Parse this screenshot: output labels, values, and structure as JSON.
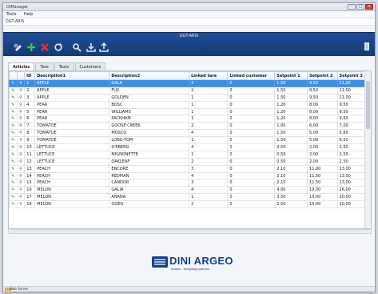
{
  "window": {
    "title": "DIManager"
  },
  "menu": {
    "items": [
      "Tools",
      "Help"
    ]
  },
  "path": {
    "text": "DGT-ARIS"
  },
  "toolbar": {
    "app_title": "DGT-ARIS",
    "accent_color": "#1f4f94"
  },
  "tabs": [
    "Articles",
    "Tare",
    "Texts",
    "Customers"
  ],
  "grid": {
    "columns": [
      "",
      "",
      "ID",
      "Description1",
      "Description2",
      "Linked tare",
      "Linked customer",
      "Setpoint 1",
      "Setpoint 2",
      "Setpoint 3"
    ],
    "rows": [
      [
        "1",
        "APPLE",
        "GALA",
        "2",
        "0",
        "1,50",
        "9,50",
        "11,00"
      ],
      [
        "2",
        "APPLE",
        "FUJI",
        "2",
        "0",
        "1,50",
        "9,50",
        "11,00"
      ],
      [
        "3",
        "APPLE",
        "GOLDEN",
        "1",
        "0",
        "1,50",
        "9,50",
        "11,00"
      ],
      [
        "4",
        "PEAR",
        "BOSC",
        "1",
        "0",
        "1,20",
        "8,00",
        "9,50"
      ],
      [
        "5",
        "PEAR",
        "WILLIAMS",
        "1",
        "0",
        "1,20",
        "8,00",
        "9,50"
      ],
      [
        "6",
        "PEAR",
        "PACKHAM",
        "1",
        "0",
        "1,20",
        "8,00",
        "9,50"
      ],
      [
        "7",
        "TOMATOE",
        "GOOSE CREEK",
        "2",
        "0",
        "1,00",
        "6,00",
        "7,00"
      ],
      [
        "8",
        "TOMATOE",
        "MOSCO",
        "4",
        "0",
        "1,50",
        "5,00",
        "5,60"
      ],
      [
        "9",
        "TOMATOE",
        "LONG-TOM",
        "1",
        "0",
        "1,50",
        "5,00",
        "6,50"
      ],
      [
        "10",
        "LETTUCE",
        "ICEBERG",
        "4",
        "0",
        "0,50",
        "2,00",
        "2,50"
      ],
      [
        "11",
        "LETTUCE",
        "MIGNONETTE",
        "1",
        "0",
        "0,50",
        "2,00",
        "2,50"
      ],
      [
        "12",
        "LETTUCE",
        "OAKLEAF",
        "2",
        "0",
        "0,50",
        "2,00",
        "2,50"
      ],
      [
        "13",
        "PEACH",
        "ENCORE",
        "3",
        "0",
        "2,10",
        "11,00",
        "13,00"
      ],
      [
        "14",
        "PEACH",
        "REDMAN",
        "4",
        "0",
        "2,10",
        "11,50",
        "13,00"
      ],
      [
        "15",
        "PEACH",
        "CANDOR",
        "3",
        "0",
        "2,10",
        "11,50",
        "13,00"
      ],
      [
        "16",
        "MELON",
        "GALIA",
        "4",
        "0",
        "4,00",
        "19,00",
        "26,00"
      ],
      [
        "17",
        "MELON",
        "ANANA",
        "1",
        "0",
        "3,50",
        "15,00",
        "20,00"
      ],
      [
        "18",
        "MELON",
        "OGEN",
        "2",
        "0",
        "2,50",
        "15,00",
        "20,00"
      ]
    ],
    "selected_row": 0
  },
  "logo": {
    "brand": "DINI ARGEO",
    "tagline": "Scales - Weighing systems",
    "color": "#16408e"
  },
  "status": {
    "text": "Web Server"
  }
}
